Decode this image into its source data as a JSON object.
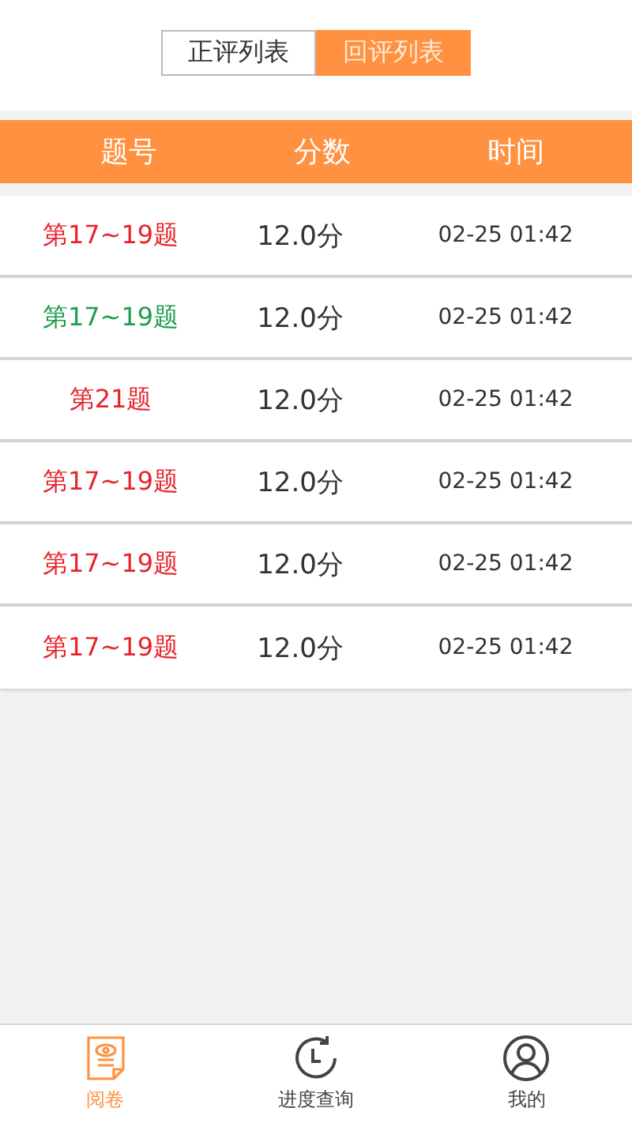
{
  "segments": [
    {
      "label": "正评列表",
      "selected": false
    },
    {
      "label": "回评列表",
      "selected": true
    }
  ],
  "table": {
    "columns": [
      "题号",
      "分数",
      "时间"
    ],
    "rows": [
      {
        "question": "第17~19题",
        "color": "#e8232b",
        "score": "12.0分",
        "time": "02-25 01:42"
      },
      {
        "question": "第17~19题",
        "color": "#1f9e4b",
        "score": "12.0分",
        "time": "02-25 01:42"
      },
      {
        "question": "第21题",
        "color": "#e8232b",
        "score": "12.0分",
        "time": "02-25 01:42"
      },
      {
        "question": "第17~19题",
        "color": "#e8232b",
        "score": "12.0分",
        "time": "02-25 01:42"
      },
      {
        "question": "第17~19题",
        "color": "#e8232b",
        "score": "12.0分",
        "time": "02-25 01:42"
      },
      {
        "question": "第17~19题",
        "color": "#e8232b",
        "score": "12.0分",
        "time": "02-25 01:42"
      }
    ]
  },
  "tab_bar": [
    {
      "kind": "paper",
      "label": "阅卷",
      "selected": true
    },
    {
      "kind": "clock",
      "label": "进度查询",
      "selected": false
    },
    {
      "kind": "user",
      "label": "我的",
      "selected": false
    }
  ]
}
